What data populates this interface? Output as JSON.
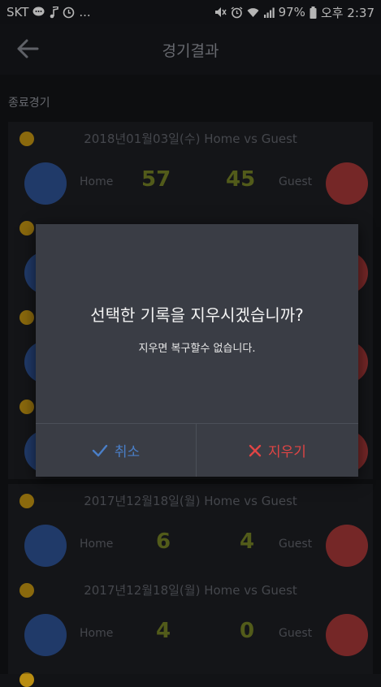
{
  "status_bar": {
    "carrier": "SKT",
    "more": "...",
    "battery": "97%",
    "time": "오후 2:37"
  },
  "app_bar": {
    "title": "경기결과"
  },
  "section": {
    "label": "종료경기"
  },
  "games": [
    {
      "date": "2018년01월03일(수)  Home vs Guest",
      "home_label": "Home",
      "guest_label": "Guest",
      "home_score": "57",
      "guest_score": "45"
    },
    {
      "date": "2017년12월18일(월)  Home vs Guest",
      "home_label": "Home",
      "guest_label": "Guest",
      "home_score": "6",
      "guest_score": "4"
    },
    {
      "date": "2017년12월18일(월)  Home vs Guest",
      "home_label": "Home",
      "guest_label": "Guest",
      "home_score": "4",
      "guest_score": "0"
    }
  ],
  "dialog": {
    "title": "선택한 기록을 지우시겠습니까?",
    "message": "지우면 복구할수 없습니다.",
    "cancel_label": "취소",
    "delete_label": "지우기"
  },
  "colors": {
    "home": "#2b4e8c",
    "guest": "#9c3435",
    "indicator": "#b98d12",
    "cancel": "#4a7fc8",
    "delete": "#e04545"
  }
}
